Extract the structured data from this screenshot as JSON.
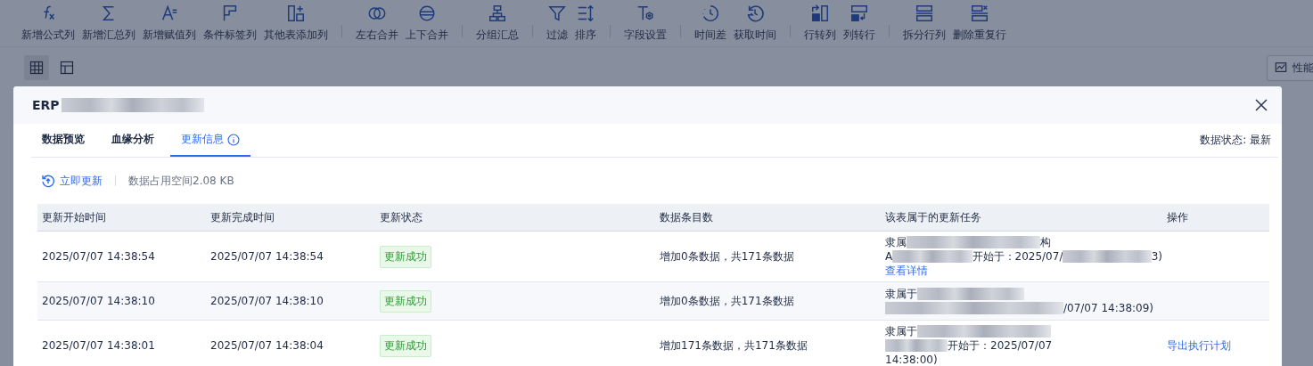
{
  "toolbar": {
    "groups": [
      [
        {
          "label": "新增公式列"
        },
        {
          "label": "新增汇总列"
        },
        {
          "label": "新增赋值列"
        },
        {
          "label": "条件标签列"
        },
        {
          "label": "其他表添加列"
        }
      ],
      [
        {
          "label": "左右合并"
        },
        {
          "label": "上下合并"
        }
      ],
      [
        {
          "label": "分组汇总"
        }
      ],
      [
        {
          "label": "过滤"
        },
        {
          "label": "排序"
        }
      ],
      [
        {
          "label": "字段设置"
        }
      ],
      [
        {
          "label": "时间差"
        },
        {
          "label": "获取时间"
        }
      ],
      [
        {
          "label": "行转列"
        },
        {
          "label": "列转行"
        }
      ],
      [
        {
          "label": "拆分行列"
        },
        {
          "label": "删除重复行"
        }
      ]
    ]
  },
  "view_buttons": [
    {
      "selected": true
    },
    {
      "selected": false
    }
  ],
  "performance_button": {
    "label": "性能"
  },
  "dialog": {
    "title": "ERP",
    "tabs": [
      {
        "label": "数据预览",
        "selected": false
      },
      {
        "label": "血缘分析",
        "selected": false
      },
      {
        "label": "更新信息",
        "selected": true,
        "info": true
      }
    ],
    "data_status": "数据状态: 最新",
    "refresh_button": "立即更新",
    "storage": "数据占用空间2.08 KB",
    "table": {
      "columns": [
        "更新开始时间",
        "更新完成时间",
        "更新状态",
        "数据条目数",
        "该表属于的更新任务",
        "操作"
      ],
      "rows": [
        {
          "start": "2025/07/07 14:38:54",
          "end": "2025/07/07 14:38:54",
          "status": "更新成功",
          "count": "增加0条数据，共171条数据",
          "task": [
            [
              {
                "kind": "text",
                "text": "隶属"
              },
              {
                "kind": "redacted"
              },
              {
                "kind": "text",
                "text": "构"
              }
            ],
            [
              {
                "kind": "text",
                "text": "A"
              },
              {
                "kind": "redacted"
              },
              {
                "kind": "text",
                "text": "开始于：2025/07/"
              },
              {
                "kind": "redacted"
              },
              {
                "kind": "text",
                "text": "3)"
              }
            ]
          ],
          "task_link": "查看详情",
          "action": null
        },
        {
          "start": "2025/07/07 14:38:10",
          "end": "2025/07/07 14:38:10",
          "status": "更新成功",
          "count": "增加0条数据，共171条数据",
          "task": [
            [
              {
                "kind": "text",
                "text": "隶属于"
              },
              {
                "kind": "redacted"
              }
            ],
            [
              {
                "kind": "redacted"
              },
              {
                "kind": "text",
                "text": "/07/07 14:38:09)"
              }
            ]
          ],
          "task_link": null,
          "action": null
        },
        {
          "start": "2025/07/07 14:38:01",
          "end": "2025/07/07 14:38:04",
          "status": "更新成功",
          "count": "增加171条数据，共171条数据",
          "task": [
            [
              {
                "kind": "text",
                "text": "隶属于"
              },
              {
                "kind": "redacted"
              }
            ],
            [
              {
                "kind": "redacted"
              },
              {
                "kind": "text",
                "text": "开始于：2025/07/07"
              }
            ],
            [
              {
                "kind": "text",
                "text": "14:38:00)"
              }
            ]
          ],
          "task_link": null,
          "action": "导出执行计划"
        }
      ]
    }
  }
}
